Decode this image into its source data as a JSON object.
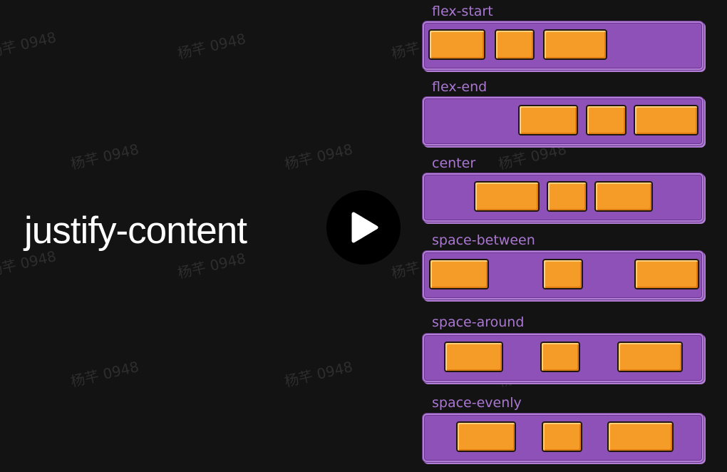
{
  "title": "justify-content",
  "play_icon": "play-icon",
  "rows": [
    {
      "label": "flex-start"
    },
    {
      "label": "flex-end"
    },
    {
      "label": "center"
    },
    {
      "label": "space-between"
    },
    {
      "label": "space-around"
    },
    {
      "label": "space-evenly"
    }
  ],
  "watermark": "杨芊 0948",
  "colors": {
    "background": "#131313",
    "track": "#8e51b8",
    "label": "#a977d2",
    "box": "#f59b28",
    "play": "#000000"
  }
}
